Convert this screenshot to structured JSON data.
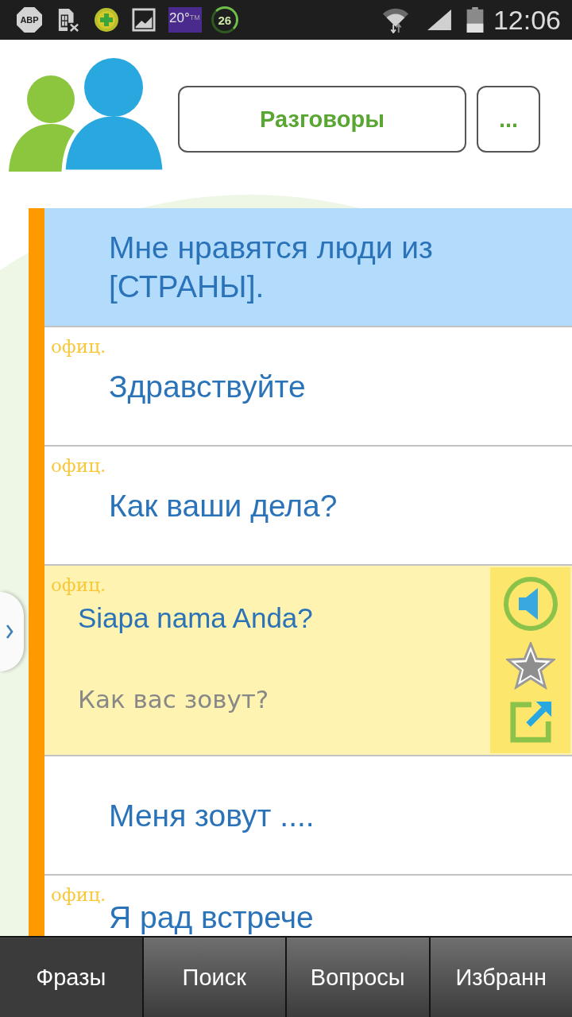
{
  "status_bar": {
    "adblock_badge": "ABP",
    "weather_temperature": "20°",
    "weather_superscript": "TM",
    "counter_badge": "26",
    "time": "12:06"
  },
  "header": {
    "category_button": "Разговоры",
    "more_button": "..."
  },
  "phrases": [
    {
      "text": "Мне нравятся люди из [СТРАНЫ].",
      "selected": true,
      "expanded": false
    },
    {
      "tag": "офиц.",
      "text": "Здравствуйте",
      "selected": false,
      "expanded": false
    },
    {
      "tag": "офиц.",
      "text": "Как ваши дела?",
      "selected": false,
      "expanded": false
    },
    {
      "tag": "офиц.",
      "text": "Siapa nama Anda?",
      "translation": "Как вас зовут?",
      "selected": false,
      "expanded": true,
      "favorite": false
    },
    {
      "text": "Меня зовут ....",
      "selected": false,
      "expanded": false
    },
    {
      "tag": "офиц.",
      "text": "Я рад встрече",
      "selected": false,
      "expanded": false
    }
  ],
  "tabs": [
    {
      "label": "Фразы",
      "selected": true
    },
    {
      "label": "Поиск",
      "selected": false
    },
    {
      "label": "Вопросы",
      "selected": false
    },
    {
      "label": "Избранн",
      "selected": false
    }
  ]
}
